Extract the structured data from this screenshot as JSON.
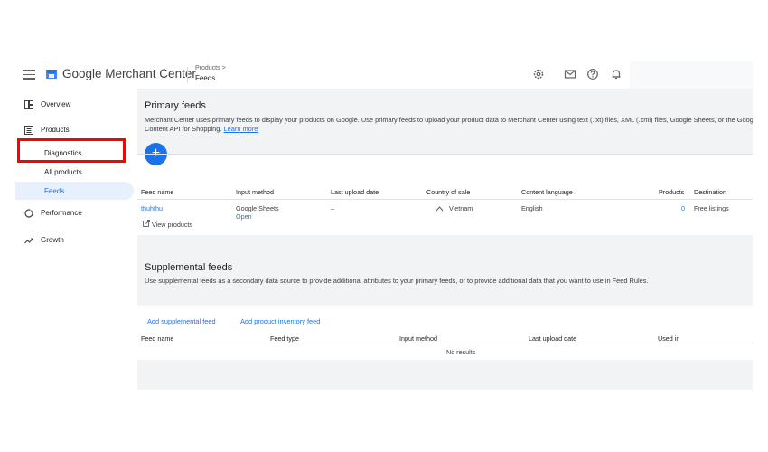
{
  "app": {
    "title": "Google Merchant Center",
    "breadcrumb_parent": "Products >",
    "breadcrumb_current": "Feeds"
  },
  "topbar_icons": [
    "settings-icon",
    "mail-icon",
    "help-icon",
    "bell-icon"
  ],
  "sidebar": {
    "items": [
      {
        "label": "Overview",
        "icon": "dashboard-icon"
      },
      {
        "label": "Products",
        "icon": "list-icon"
      },
      {
        "label": "Diagnostics"
      },
      {
        "label": "All products"
      },
      {
        "label": "Feeds"
      },
      {
        "label": "Performance",
        "icon": "performance-icon"
      },
      {
        "label": "Growth",
        "icon": "growth-icon"
      }
    ]
  },
  "primary_feeds": {
    "title": "Primary feeds",
    "description": "Merchant Center uses primary feeds to display your products on Google. Use primary feeds to upload your product data to Merchant Center using text (.txt) files, XML (.xml) files, Google Sheets, or the Google Content API for Shopping.",
    "learn_more": "Learn more",
    "add_button": "+",
    "columns": [
      "Feed name",
      "Input method",
      "Last upload date",
      "Country of sale",
      "Content language",
      "Products",
      "Destination"
    ],
    "rows": [
      {
        "feed_name": "thuhthu",
        "input_method": "Google Sheets",
        "input_action": "Open",
        "last_upload": "–",
        "country": "Vietnam",
        "language": "English",
        "products": "0",
        "destination": "Free listings",
        "view_products": "View products"
      }
    ]
  },
  "supplemental_feeds": {
    "title": "Supplemental feeds",
    "description": "Use supplemental feeds as a secondary data source to provide additional attributes to your primary feeds, or to provide additional data that you want to use in Feed Rules.",
    "add_supplemental": "Add supplemental feed",
    "add_inventory": "Add product inventory feed",
    "columns": [
      "Feed name",
      "Feed type",
      "Input method",
      "Last upload date",
      "Used in"
    ],
    "empty": "No results"
  },
  "colors": {
    "accent": "#1a73e8",
    "highlight": "#ff0000",
    "background": "#f1f3f4"
  }
}
